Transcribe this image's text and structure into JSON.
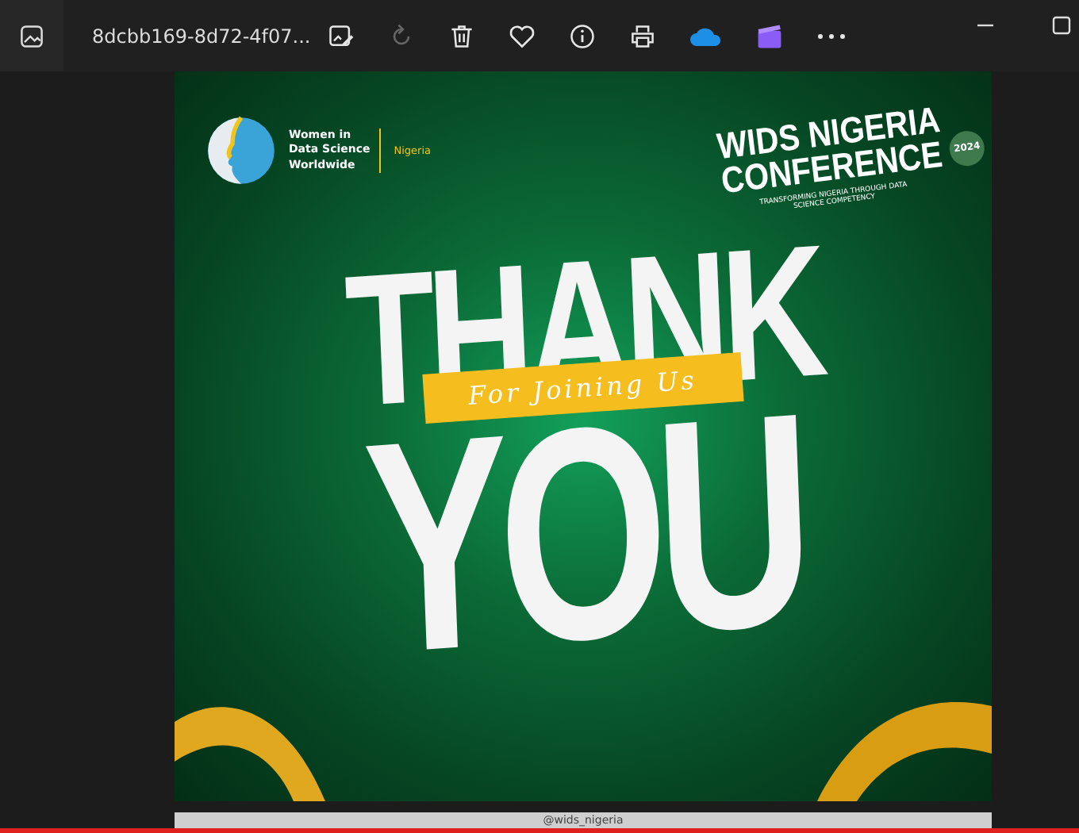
{
  "window": {
    "title": "8dcbb169-8d72-4f07..."
  },
  "toolbar": [
    {
      "kind": "edit",
      "disabled": false
    },
    {
      "kind": "rotate",
      "disabled": true
    },
    {
      "kind": "delete",
      "disabled": false
    },
    {
      "kind": "favorite",
      "disabled": false
    },
    {
      "kind": "info",
      "disabled": false
    },
    {
      "kind": "print",
      "disabled": false
    },
    {
      "kind": "cloud",
      "disabled": false
    },
    {
      "kind": "video",
      "disabled": false
    },
    {
      "kind": "more",
      "disabled": false
    }
  ],
  "poster": {
    "org_lines": [
      "Women in",
      "Data Science",
      "Worldwide"
    ],
    "org_region": "Nigeria",
    "event_lines": [
      "WIDS NIGERIA",
      "CONFERENCE"
    ],
    "event_year": "2024",
    "event_tagline": "TRANSFORMING NIGERIA THROUGH DATA SCIENCE COMPETENCY",
    "headline_top": "THANK",
    "ribbon": "For Joining Us",
    "headline_bottom": "YOU",
    "handle": "@wids_nigeria"
  }
}
